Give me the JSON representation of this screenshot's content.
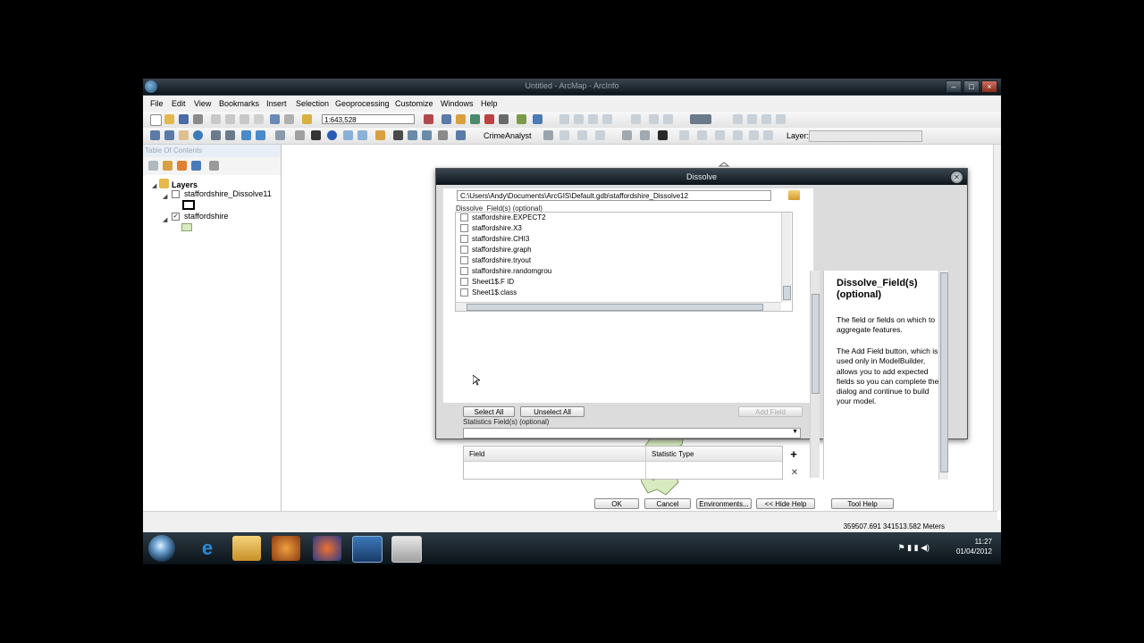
{
  "window": {
    "title": "Untitled - ArcMap - ArcInfo"
  },
  "menu": [
    "File",
    "Edit",
    "View",
    "Bookmarks",
    "Insert",
    "Selection",
    "Geoprocessing",
    "Customize",
    "Windows",
    "Help"
  ],
  "toolbar": {
    "scale": "1:643,528",
    "crime_analyst": "CrimeAnalyst",
    "layer_label": "Layer:"
  },
  "toc": {
    "title": "Table Of Contents",
    "layers_label": "Layers",
    "layers": [
      {
        "name": "staffordshire_Dissolve11",
        "checked": false
      },
      {
        "name": "staffordshire",
        "checked": true
      }
    ]
  },
  "status": {
    "coords": "359507.691  341513.582 Meters"
  },
  "taskbar": {
    "time": "11:27",
    "date": "01/04/2012"
  },
  "dialog": {
    "title": "Dissolve",
    "input_path": "C:\\Users\\Andy\\Documents\\ArcGIS\\Default.gdb\\staffordshire_Dissolve12",
    "dissolve_label": "Dissolve_Field(s) (optional)",
    "fields": [
      "staffordshire.EXPECT2",
      "staffordshire.X3",
      "staffordshire.CHI3",
      "staffordshire.graph",
      "staffordshire.tryout",
      "staffordshire.randomgrou",
      "Sheet1$.F ID",
      "Sheet1$.class"
    ],
    "select_all": "Select All",
    "unselect_all": "Unselect All",
    "add_field": "Add Field",
    "stats_label": "Statistics Field(s) (optional)",
    "stats_columns": [
      "Field",
      "Statistic Type"
    ],
    "buttons": {
      "ok": "OK",
      "cancel": "Cancel",
      "environments": "Environments...",
      "hide_help": "<< Hide Help",
      "tool_help": "Tool Help"
    },
    "help": {
      "title": "Dissolve_Field(s) (optional)",
      "p1": "The field or fields on which to aggregate features.",
      "p2": "The Add Field button, which is used only in ModelBuilder, allows you to add expected fields so you can complete the dialog and continue to build your model."
    }
  }
}
